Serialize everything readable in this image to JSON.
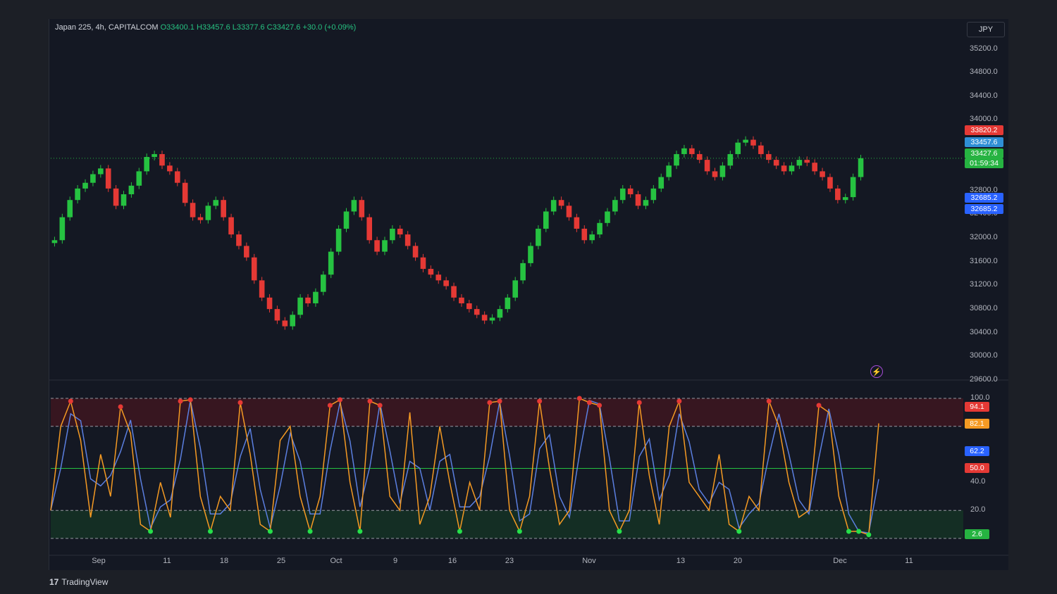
{
  "header": {
    "symbol": "Japan 225, 4h, CAPITALCOM",
    "ohlc": "O33400.1 H33457.6 L33377.6 C33427.6 +30.0 (+0.09%)",
    "currency": "JPY"
  },
  "price_axis": [
    "35200.0",
    "34800.0",
    "34400.0",
    "34000.0",
    "32800.0",
    "32400.0",
    "32000.0",
    "31600.0",
    "31200.0",
    "30800.0",
    "30400.0",
    "30000.0",
    "29600.0"
  ],
  "price_tags": {
    "high_tag": "33820.2",
    "high_color": "#e53935",
    "bid_tag": "33457.6",
    "bid_color": "#2f8fd6",
    "last_price": "33427.6",
    "countdown": "01:59:34",
    "last_color": "#26b341",
    "low_tag_1": "32685.2",
    "low_tag_2": "32685.2",
    "low_color": "#2962ff"
  },
  "oscillator": {
    "axis": [
      "100.0",
      "40.0",
      "20.0"
    ],
    "tags": {
      "k": "94.1",
      "k_color": "#e53935",
      "d": "82.1",
      "d_color": "#f59a23",
      "v": "62.2",
      "v_color": "#2962ff",
      "mid": "50.0",
      "mid_color": "#e53935",
      "low": "2.6",
      "low_color": "#26b341"
    },
    "levels": {
      "upper": 80,
      "lower": 20,
      "top": 100,
      "bottom": 0,
      "mid": 50
    }
  },
  "x_axis": [
    "Sep",
    "11",
    "18",
    "25",
    "Oct",
    "9",
    "16",
    "23",
    "Nov",
    "13",
    "20",
    "Dec",
    "11"
  ],
  "brand": "TradingView",
  "chart_data": {
    "type": "candlestick",
    "title": "Japan 225, 4h, CAPITALCOM",
    "ylim": [
      29600,
      35400
    ],
    "price_series": [
      32000,
      32400,
      32700,
      32900,
      33000,
      33150,
      33250,
      32900,
      32600,
      32800,
      32950,
      33200,
      33450,
      33500,
      33300,
      33200,
      33000,
      32650,
      32400,
      32350,
      32600,
      32700,
      32400,
      32100,
      31900,
      31700,
      31300,
      31000,
      30800,
      30600,
      30500,
      30700,
      31000,
      30900,
      31100,
      31400,
      31800,
      32200,
      32500,
      32700,
      32400,
      32000,
      31800,
      32000,
      32200,
      32100,
      31900,
      31700,
      31500,
      31400,
      31300,
      31200,
      31000,
      30900,
      30800,
      30700,
      30600,
      30650,
      30800,
      31000,
      31300,
      31600,
      31900,
      32200,
      32500,
      32700,
      32600,
      32400,
      32200,
      32000,
      32100,
      32300,
      32500,
      32700,
      32900,
      32800,
      32600,
      32700,
      32900,
      33100,
      33300,
      33500,
      33600,
      33500,
      33400,
      33200,
      33100,
      33300,
      33500,
      33700,
      33750,
      33650,
      33500,
      33400,
      33300,
      33200,
      33300,
      33400,
      33350,
      33200,
      33100,
      32900,
      32700,
      32750,
      33100,
      33427.6
    ],
    "oscillator_series": [
      20,
      80,
      98,
      70,
      15,
      60,
      30,
      94,
      75,
      10,
      5,
      40,
      15,
      98,
      99,
      30,
      5,
      30,
      20,
      97,
      60,
      10,
      5,
      70,
      80,
      30,
      5,
      30,
      95,
      99,
      40,
      5,
      98,
      95,
      30,
      20,
      90,
      10,
      30,
      80,
      40,
      5,
      40,
      20,
      97,
      98,
      20,
      5,
      30,
      98,
      50,
      10,
      20,
      100,
      97,
      95,
      20,
      5,
      20,
      97,
      45,
      10,
      80,
      98,
      40,
      30,
      20,
      60,
      10,
      5,
      30,
      20,
      98,
      80,
      40,
      15,
      20,
      95,
      90,
      30,
      5,
      5,
      2.6,
      82.1
    ],
    "oscillator_ylim": [
      0,
      100
    ],
    "oscillator_levels": [
      0,
      20,
      50,
      80,
      100
    ],
    "x_labels": [
      "Sep",
      "11",
      "18",
      "25",
      "Oct",
      "9",
      "16",
      "23",
      "Nov",
      "13",
      "20",
      "Dec",
      "11"
    ]
  }
}
